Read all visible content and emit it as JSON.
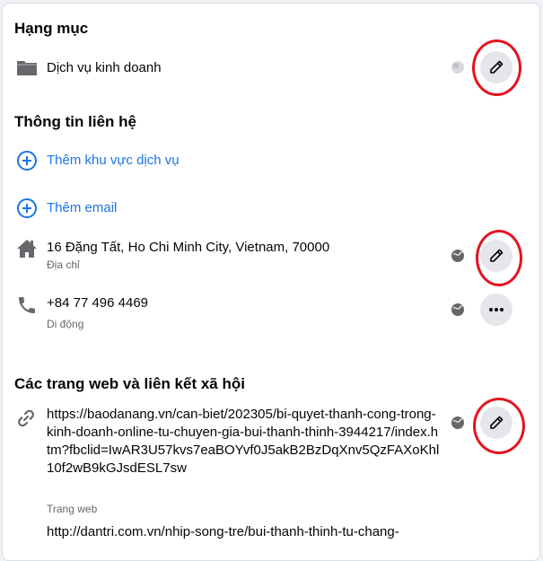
{
  "category": {
    "heading": "Hạng mục",
    "value": "Dịch vụ kinh doanh",
    "icon": "folder-icon"
  },
  "contact": {
    "heading": "Thông tin liên hệ",
    "add_service_area": "Thêm khu vực dịch vụ",
    "add_email": "Thêm email",
    "address": {
      "value": "16 Đặng Tất, Ho Chi Minh City, Vietnam, 70000",
      "label": "Địa chỉ",
      "icon": "home-icon"
    },
    "phone": {
      "value": "+84 77 496 4469",
      "label": "Di động",
      "icon": "phone-icon"
    }
  },
  "websites": {
    "heading": "Các trang web và liên kết xã hội",
    "items": [
      {
        "url": "https://baodanang.vn/can-biet/202305/bi-quyet-thanh-cong-trong-kinh-doanh-online-tu-chuyen-gia-bui-thanh-thinh-3944217/index.htm?fbclid=IwAR3U57kvs7eaBOYvf0J5akB2BzDqXnv5QzFAXoKhl10f2wB9kGJsdESL7sw",
        "label": "Trang web",
        "icon": "link-icon"
      },
      {
        "url": "http://dantri.com.vn/nhip-song-tre/bui-thanh-thinh-tu-chang-",
        "label": ""
      }
    ]
  },
  "colors": {
    "link": "#1b74e4",
    "highlight_ring": "#e6121d",
    "button_bg": "#e4e6eb"
  }
}
